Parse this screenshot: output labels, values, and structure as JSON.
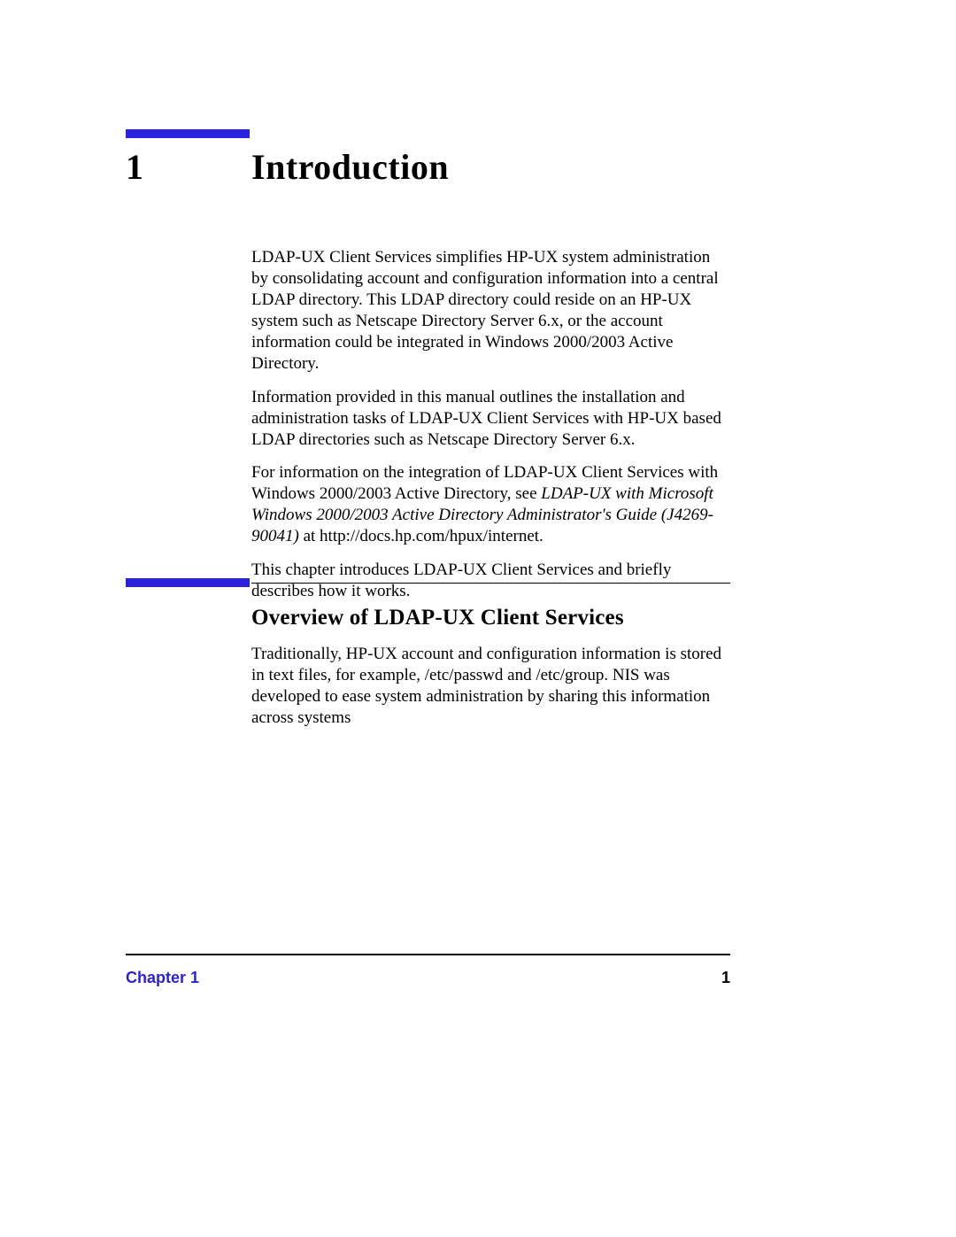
{
  "chapter": {
    "number": "1",
    "title": "Introduction"
  },
  "intro": {
    "p1": "LDAP-UX Client Services simplifies HP-UX system administration by consolidating account and configuration information into a central LDAP directory. This LDAP directory could reside on an HP-UX system such as Netscape Directory Server 6.x, or the account information could be integrated in Windows 2000/2003 Active Directory.",
    "p2": "Information provided in this manual outlines the installation and administration tasks of LDAP-UX Client Services with HP-UX based LDAP directories such as Netscape Directory Server 6.x.",
    "p3a": "For information on the integration of LDAP-UX Client Services with Windows 2000/2003 Active Directory, see ",
    "p3_italic": "LDAP-UX with Microsoft Windows 2000/2003 Active Directory Administrator's Guide (J4269-90041)",
    "p3b": " at http://docs.hp.com/hpux/internet.",
    "p4": "This chapter introduces LDAP-UX Client Services and briefly describes how it works."
  },
  "section": {
    "heading": "Overview of LDAP-UX Client Services",
    "p1": "Traditionally, HP-UX account and configuration information is stored in text files, for example, /etc/passwd and /etc/group. NIS was developed to ease system administration by sharing this information across systems"
  },
  "footer": {
    "left": "Chapter 1",
    "right": "1"
  },
  "colors": {
    "accent": "#2a22dd"
  }
}
